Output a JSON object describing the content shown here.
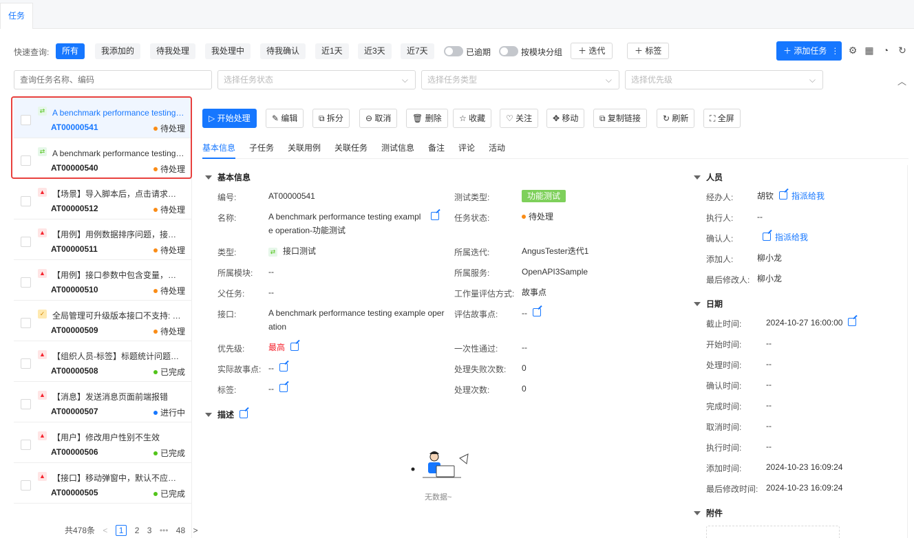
{
  "top_tab": "任务",
  "quick": {
    "label": "快速查询:",
    "buttons": [
      "所有",
      "我添加的",
      "待我处理",
      "我处理中",
      "待我确认",
      "近1天",
      "近3天",
      "近7天"
    ],
    "overdue": "已逾期",
    "group_by_module": "按模块分组",
    "sprint_btn": "迭代",
    "tag_btn": "标签",
    "add_task": "添加任务"
  },
  "filters": {
    "search_placeholder": "查询任务名称、编码",
    "status": "选择任务状态",
    "type": "选择任务类型",
    "priority": "选择优先级"
  },
  "tasks": [
    {
      "title": "A benchmark performance testing example operation-功能测试",
      "code": "AT00000541",
      "status": "待处理",
      "icon": "api",
      "color": "#fa8c16"
    },
    {
      "title": "A benchmark performance testing example operation-性能测试",
      "code": "AT00000540",
      "status": "待处理",
      "icon": "api",
      "color": "#fa8c16"
    },
    {
      "title": "【场景】导入脚本后，点击请求体无法展示",
      "code": "AT00000512",
      "status": "待处理",
      "icon": "bug",
      "color": "#fa8c16"
    },
    {
      "title": "【用例】用例数据排序问题，接口返回异常",
      "code": "AT00000511",
      "status": "待处理",
      "icon": "bug",
      "color": "#fa8c16"
    },
    {
      "title": "【用例】接口参数中包含变量，调试失败问题",
      "code": "AT00000510",
      "status": "待处理",
      "icon": "bug",
      "color": "#fa8c16"
    },
    {
      "title": "全局管理可升级版本接口不支持: 查询问题",
      "code": "AT00000509",
      "status": "待处理",
      "icon": "req",
      "color": "#fa8c16"
    },
    {
      "title": "【组织人员-标签】标题统计问题修复优化",
      "code": "AT00000508",
      "status": "已完成",
      "icon": "bug",
      "color": "#52c41a"
    },
    {
      "title": "【消息】发送消息页面前端报错",
      "code": "AT00000507",
      "status": "进行中",
      "icon": "bug",
      "color": "#1677ff"
    },
    {
      "title": "【用户】修改用户性别不生效",
      "code": "AT00000506",
      "status": "已完成",
      "icon": "bug",
      "color": "#52c41a"
    },
    {
      "title": "【接口】移动弹窗中，默认不应展示根目录",
      "code": "AT00000505",
      "status": "已完成",
      "icon": "bug",
      "color": "#52c41a"
    }
  ],
  "pager": {
    "total": "共478条",
    "prev": "<",
    "p1": "1",
    "p2": "2",
    "p3": "3",
    "more": "•••",
    "last": "48",
    "next": ">"
  },
  "actions": [
    "开始处理",
    "编辑",
    "拆分",
    "取消",
    "删除",
    "收藏",
    "关注",
    "移动",
    "复制链接",
    "刷新",
    "全屏"
  ],
  "detail_tabs": [
    "基本信息",
    "子任务",
    "关联用例",
    "关联任务",
    "测试信息",
    "备注",
    "评论",
    "活动"
  ],
  "basic": {
    "section": "基本信息",
    "code_l": "编号:",
    "code_v": "AT00000541",
    "name_l": "名称:",
    "name_v": "A benchmark performance testing example operation-功能测试",
    "type_l": "类型:",
    "type_v": "接口测试",
    "module_l": "所属模块:",
    "module_v": "--",
    "parent_l": "父任务:",
    "parent_v": "--",
    "api_l": "接口:",
    "api_v": "A benchmark performance testing example operation",
    "prio_l": "优先级:",
    "prio_v": "最高",
    "actual_l": "实际故事点:",
    "actual_v": "--",
    "tag_l": "标签:",
    "tag_v": "--",
    "ttype_l": "测试类型:",
    "ttype_v": "功能测试",
    "tstatus_l": "任务状态:",
    "tstatus_v": "待处理",
    "sprint_l": "所属迭代:",
    "sprint_v": "AngusTester迭代1",
    "service_l": "所属服务:",
    "service_v": "OpenAPI3Sample",
    "est_l": "工作量评估方式:",
    "est_v": "故事点",
    "story_l": "评估故事点:",
    "story_v": "--",
    "once_l": "一次性通过:",
    "once_v": "--",
    "fail_l": "处理失败次数:",
    "fail_v": "0",
    "proc_l": "处理次数:",
    "proc_v": "0"
  },
  "desc": {
    "section": "描述",
    "empty": "无数据~"
  },
  "people": {
    "section": "人员",
    "assignee_l": "经办人:",
    "assignee_v": "胡钦",
    "assign_me": "指派给我",
    "executor_l": "执行人:",
    "executor_v": "--",
    "confirmer_l": "确认人:",
    "confirm_me": "指派给我",
    "creator_l": "添加人:",
    "creator_v": "柳小龙",
    "modifier_l": "最后修改人:",
    "modifier_v": "柳小龙"
  },
  "dates": {
    "section": "日期",
    "deadline_l": "截止时间:",
    "deadline_v": "2024-10-27 16:00:00",
    "start_l": "开始时间:",
    "start_v": "--",
    "proc_l": "处理时间:",
    "proc_v": "--",
    "confirm_l": "确认时间:",
    "confirm_v": "--",
    "done_l": "完成时间:",
    "done_v": "--",
    "cancel_l": "取消时间:",
    "cancel_v": "--",
    "exec_l": "执行时间:",
    "exec_v": "--",
    "add_l": "添加时间:",
    "add_v": "2024-10-23 16:09:24",
    "mod_l": "最后修改时间:",
    "mod_v": "2024-10-23 16:09:24"
  },
  "attach": {
    "section": "附件"
  }
}
